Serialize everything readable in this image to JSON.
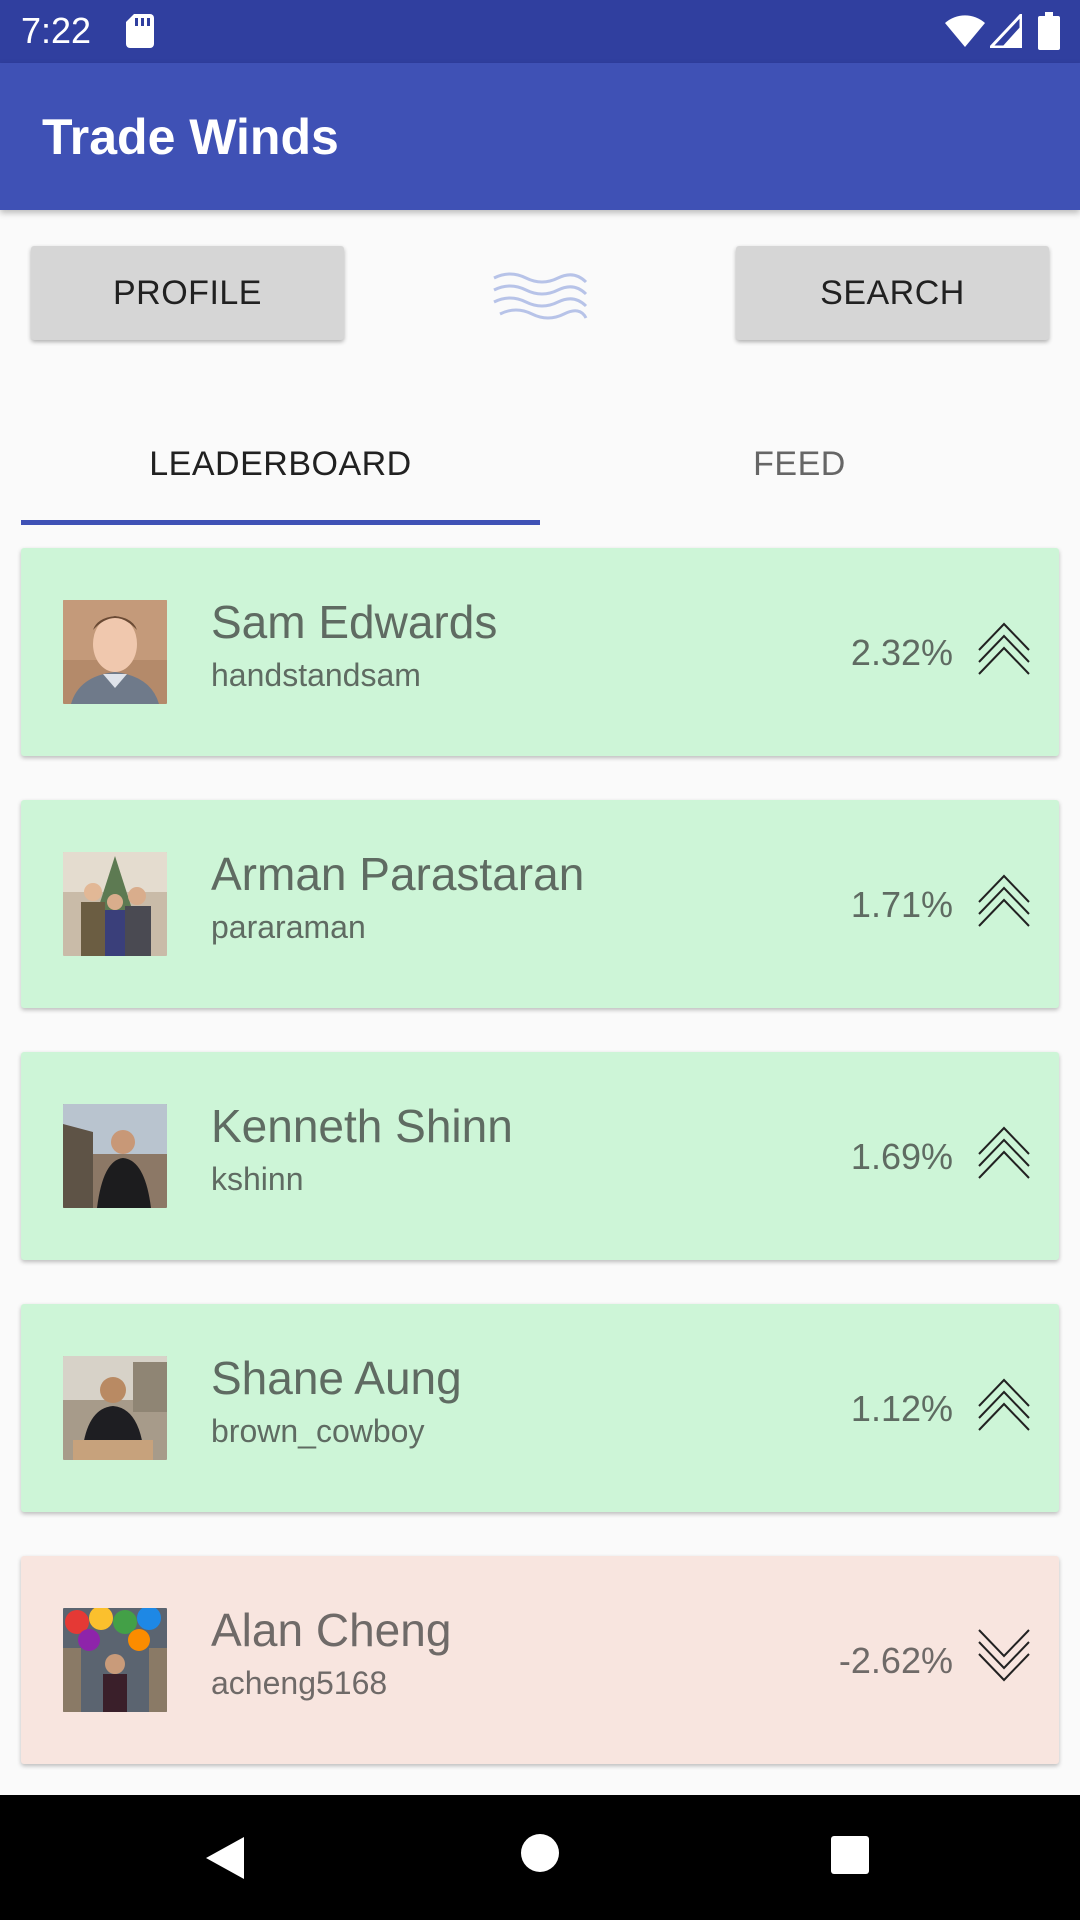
{
  "status_bar": {
    "time": "7:22",
    "icons": [
      "sd-card-icon",
      "wifi-icon",
      "signal-icon",
      "battery-icon"
    ]
  },
  "app_bar": {
    "title": "Trade Winds",
    "color": "#3f51b5"
  },
  "actions": {
    "profile_label": "PROFILE",
    "search_label": "SEARCH",
    "logo_icon": "waves-icon"
  },
  "tabs": [
    {
      "label": "LEADERBOARD",
      "selected": true
    },
    {
      "label": "FEED",
      "selected": false
    }
  ],
  "leaderboard": [
    {
      "name": "Sam Edwards",
      "username": "handstandsam",
      "change": "2.32%",
      "trend": "up"
    },
    {
      "name": "Arman Parastaran",
      "username": "pararaman",
      "change": "1.71%",
      "trend": "up"
    },
    {
      "name": "Kenneth Shinn",
      "username": "kshinn",
      "change": "1.69%",
      "trend": "up"
    },
    {
      "name": "Shane Aung",
      "username": "brown_cowboy",
      "change": "1.12%",
      "trend": "up"
    },
    {
      "name": "Alan Cheng",
      "username": "acheng5168",
      "change": "-2.62%",
      "trend": "down"
    }
  ],
  "colors": {
    "status_bar": "#303f9f",
    "accent": "#3f51b5",
    "gain_card": "#cdf5d7",
    "loss_card": "#f8e5df"
  },
  "nav_bar": {
    "icons": [
      "back-icon",
      "home-icon",
      "recents-icon"
    ]
  }
}
